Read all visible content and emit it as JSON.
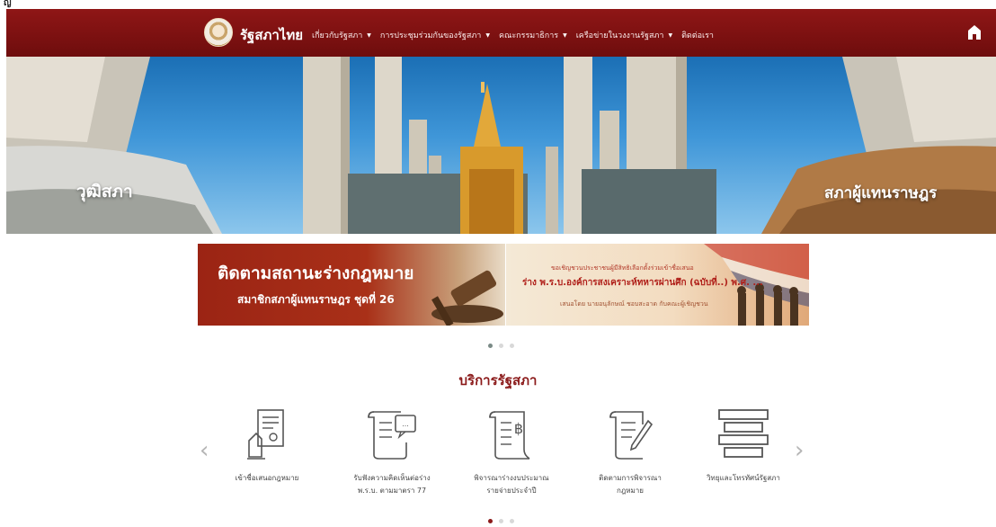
{
  "top_strip": {
    "text": "ญ"
  },
  "header": {
    "site_name": "รัฐสภาไทย",
    "menu": [
      {
        "label": "เกี่ยวกับรัฐสภา",
        "has_dropdown": true
      },
      {
        "label": "การประชุมร่วมกันของรัฐสภา",
        "has_dropdown": true
      },
      {
        "label": "คณะกรรมาธิการ",
        "has_dropdown": true
      },
      {
        "label": "เครือข่ายในวงงานรัฐสภา",
        "has_dropdown": true
      },
      {
        "label": "ติดต่อเรา",
        "has_dropdown": false
      }
    ],
    "home_icon": "home-icon",
    "colors": {
      "nav_bg": "#7d1010",
      "text": "#ffffff"
    }
  },
  "hero": {
    "left_label": "วุฒิสภา",
    "right_label": "สภาผู้แทนราษฎร"
  },
  "promos": {
    "left": {
      "title": "ติดตามสถานะร่างกฎหมาย",
      "subtitle": "สมาชิกสภาผู้แทนราษฎร ชุดที่ 26"
    },
    "right": {
      "line1": "ขอเชิญชวนประชาชนผู้มีสิทธิเลือกตั้งร่วมเข้าชื่อเสนอ",
      "line2": "ร่าง พ.ร.บ.องค์การสงเคราะห์ทหารผ่านศึก (ฉบับที่..) พ.ศ. ...",
      "line3": "เสนอโดย นายอนุลักษณ์ ชอบสะอาด กับคณะผู้เชิญชวน"
    },
    "carousel_dots": 3,
    "active_dot": 0
  },
  "services": {
    "title": "บริการรัฐสภา",
    "prev_icon": "chevron-left-icon",
    "next_icon": "chevron-right-icon",
    "items": [
      {
        "label": "เข้าชื่อเสนอกฎหมาย",
        "icon": "document-hand-icon"
      },
      {
        "label": "รับฟังความคิดเห็นต่อร่าง\nพ.ร.บ. ตามมาตรา 77",
        "icon": "scroll-comment-icon"
      },
      {
        "label": "พิจารณาร่างงบประมาณ\nรายจ่ายประจำปี",
        "icon": "scroll-baht-icon"
      },
      {
        "label": "ติดตามการพิจารณา\nกฎหมาย",
        "icon": "scroll-pen-icon"
      },
      {
        "label": "วิทยุและโทรทัศน์รัฐสภา",
        "icon": "layers-icon"
      }
    ],
    "carousel_dots": 3,
    "active_dot": 0,
    "accent": "#8b1a1a"
  }
}
